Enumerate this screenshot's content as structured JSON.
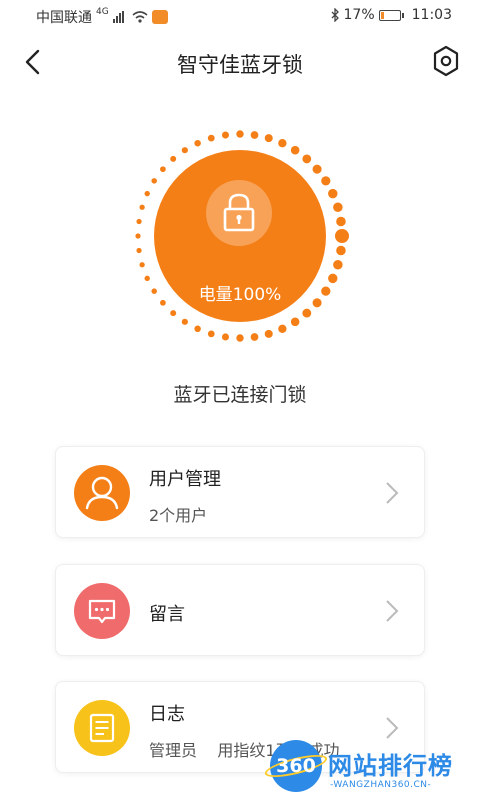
{
  "status_bar": {
    "carrier": "中国联通",
    "network": "4G",
    "battery_percent": "17%",
    "battery_level": 0.17,
    "time": "11:03"
  },
  "nav": {
    "title": "智守佳蓝牙锁"
  },
  "lock": {
    "battery_label": "电量100%",
    "battery_level": 1.0,
    "status": "蓝牙已连接门锁"
  },
  "menu": [
    {
      "title": "用户管理",
      "subtitle": "2个用户",
      "icon": "user-icon",
      "color": "#f57f17"
    },
    {
      "title": "留言",
      "subtitle": "",
      "icon": "message-icon",
      "color": "#f06c6c"
    },
    {
      "title": "日志",
      "subtitle": "管理员    用指纹1开门成功",
      "icon": "log-icon",
      "color": "#f7c21a"
    }
  ],
  "watermark": {
    "logo_text": "360",
    "cn": "网站排行榜",
    "en": "-WANGZHAN360.CN-"
  },
  "colors": {
    "accent": "#f57f17",
    "message": "#f06c6c",
    "log": "#f7c21a",
    "watermark": "#2d8ae6"
  }
}
